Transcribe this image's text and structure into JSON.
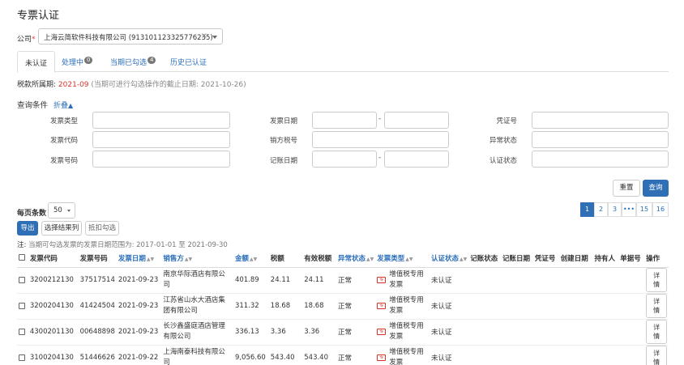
{
  "page": {
    "title": "专票认证"
  },
  "company": {
    "label": "公司",
    "required_mark": "*",
    "value": "上海云简软件科技有限公司 (913101123325776235)",
    "clear_glyph": "×"
  },
  "tabs": [
    {
      "label": "未认证",
      "badge": null,
      "active": true
    },
    {
      "label": "处理中",
      "badge": "0",
      "active": false
    },
    {
      "label": "当期已勾选",
      "badge": "4",
      "active": false
    },
    {
      "label": "历史已认证",
      "badge": null,
      "active": false
    }
  ],
  "tax_period": {
    "label": "税款所属期:",
    "value": "2021-09",
    "note": "(当期可进行勾选操作的截止日期: 2021-10-26)"
  },
  "query": {
    "title": "查询条件",
    "collapse_label": "折叠",
    "fields": {
      "invoice_type": "发票类型",
      "invoice_date": "发票日期",
      "voucher_no": "凭证号",
      "invoice_code": "发票代码",
      "seller_tax_no": "销方税号",
      "abnormal_status": "异常状态",
      "invoice_no": "发票号码",
      "booking_date": "记账日期",
      "cert_status": "认证状态"
    },
    "range_sep": "-",
    "reset_label": "重置",
    "search_label": "查询"
  },
  "list": {
    "page_size_label": "每页条数",
    "page_size": "50",
    "export_label": "导出",
    "select_columns_label": "选择结果列",
    "deduct_label": "抵扣勾选",
    "pagination": [
      "1",
      "2",
      "3",
      "•••",
      "15",
      "16"
    ],
    "note_prefix": "注:",
    "note_text": "当期可勾选发票的发票日期范围为: 2017-01-01 至 2021-09-30"
  },
  "table": {
    "headers": [
      "发票代码",
      "发票号码",
      "发票日期",
      "销售方",
      "金额",
      "税额",
      "有效税额",
      "异常状态",
      "发票类型",
      "认证状态",
      "记账状态",
      "记账日期",
      "凭证号",
      "创建日期",
      "持有人",
      "单据号",
      "操作"
    ],
    "detail_label": "详情",
    "type_icon_text": "专",
    "rows": [
      {
        "code": "3200212130",
        "number": "37517514",
        "date": "2021-09-23",
        "seller": "南京华际酒店有限公司",
        "amount": "401.89",
        "tax": "24.11",
        "valid_tax": "24.11",
        "abnormal": "正常",
        "type": "增值税专用发票",
        "cert": "未认证"
      },
      {
        "code": "3200204130",
        "number": "41424504",
        "date": "2021-09-23",
        "seller": "江苏省山水大酒店集团有限公司",
        "amount": "311.32",
        "tax": "18.68",
        "valid_tax": "18.68",
        "abnormal": "正常",
        "type": "增值税专用发票",
        "cert": "未认证"
      },
      {
        "code": "4300201130",
        "number": "00648898",
        "date": "2021-09-23",
        "seller": "长沙鑫盛庭酒店管理有限公司",
        "amount": "336.13",
        "tax": "3.36",
        "valid_tax": "3.36",
        "abnormal": "正常",
        "type": "增值税专用发票",
        "cert": "未认证"
      },
      {
        "code": "3100204130",
        "number": "51446626",
        "date": "2021-09-22",
        "seller": "上海南泰科技有限公司",
        "amount": "9,056.60",
        "tax": "543.40",
        "valid_tax": "543.40",
        "abnormal": "正常",
        "type": "增值税专用发票",
        "cert": "未认证"
      }
    ]
  },
  "colors": {
    "accent": "#2f6fb5",
    "link": "#2a6ebb",
    "red": "#d9342b"
  }
}
